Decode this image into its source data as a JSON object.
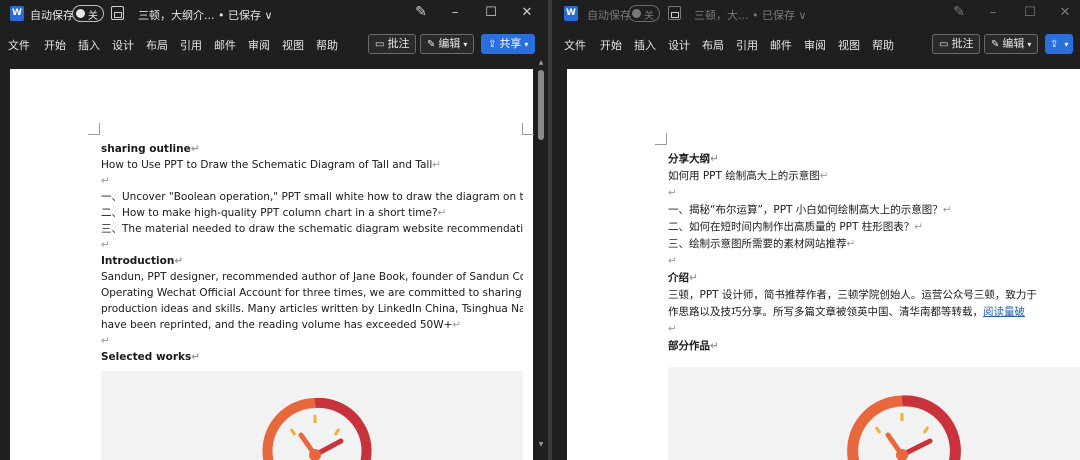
{
  "left": {
    "titlebar": {
      "logo": "W",
      "autosave_label": "自动保存",
      "toggle_label": "关",
      "doc_title": "三顿，大纲介... • 已保存 ∨"
    },
    "ribbon": {
      "menu": [
        "文件",
        "开始",
        "插入",
        "设计",
        "布局",
        "引用",
        "邮件",
        "审阅",
        "视图",
        "帮助"
      ],
      "comment_label": "批注",
      "edit_label": "编辑",
      "share_label": "共享"
    },
    "doc": {
      "heading1": "sharing outline",
      "subtitle": "How to Use PPT to Draw the Schematic Diagram of Tall and Tall",
      "items": [
        "一、Uncover \"Boolean operation,\" PPT small white how to draw the diagram on the tall?",
        "二、How to make high-quality PPT column chart in a short time?",
        "三、The material needed to draw the schematic diagram website recommendation"
      ],
      "heading2": "Introduction",
      "intro": [
        "Sandun, PPT designer, recommended author of Jane Book, founder of Sandun College.",
        "Operating Wechat Official Account for three times, we are committed to sharing PPT-related",
        "production ideas and skills. Many articles written by LinkedIn China, Tsinghua Nandu, etc.",
        "have been reprinted, and the reading volume has exceeded 50W+"
      ],
      "heading3": "Selected works"
    }
  },
  "right": {
    "titlebar": {
      "logo": "W",
      "autosave_label": "自动保存",
      "toggle_label": "关",
      "doc_title": "三顿，大... • 已保存 ∨"
    },
    "ribbon": {
      "menu": [
        "文件",
        "开始",
        "插入",
        "设计",
        "布局",
        "引用",
        "邮件",
        "审阅",
        "视图",
        "帮助"
      ],
      "comment_label": "批注",
      "edit_label": "编辑"
    },
    "doc": {
      "heading1": "分享大纲",
      "subtitle": "如何用 PPT 绘制高大上的示意图",
      "items": [
        "一、揭秘“布尔运算”，PPT 小白如何绘制高大上的示意图？",
        "二、如何在短时间内制作出高质量的 PPT 柱形图表？",
        "三、绘制示意图所需要的素材网站推荐"
      ],
      "heading2": "介绍",
      "intro": [
        "三顿，PPT 设计师，简书推荐作者，三顿学院创始人。运营公众号三顿，致力于",
        "作思路以及技巧分享。所写多篇文章被领英中国、清华南都等转载，"
      ],
      "intro_link": "阅读量破",
      "heading3": "部分作品"
    }
  },
  "para_mark": "↵",
  "colors": {
    "titlebar_bg": "#1f1f1f",
    "share_blue": "#2a6fdc",
    "clock_red": "#c8323a",
    "clock_orange": "#e8673c",
    "clock_yellow": "#f0b33a"
  }
}
